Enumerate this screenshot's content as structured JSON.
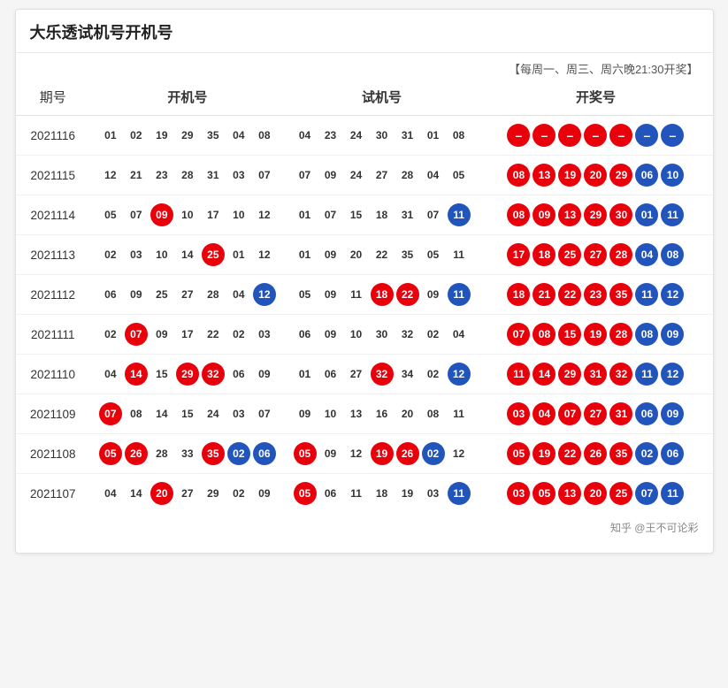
{
  "title": "大乐透试机号开机号",
  "subtitle": "【每周一、周三、周六晚21:30开奖】",
  "columns": [
    "期号",
    "开机号",
    "试机号",
    "开奖号"
  ],
  "rows": [
    {
      "period": "2021116",
      "kaiji": [
        {
          "val": "01",
          "type": "plain"
        },
        {
          "val": "02",
          "type": "plain"
        },
        {
          "val": "19",
          "type": "plain"
        },
        {
          "val": "29",
          "type": "plain"
        },
        {
          "val": "35",
          "type": "plain"
        },
        {
          "val": "04",
          "type": "plain"
        },
        {
          "val": "08",
          "type": "plain"
        }
      ],
      "shiji": [
        {
          "val": "04",
          "type": "plain"
        },
        {
          "val": "23",
          "type": "plain"
        },
        {
          "val": "24",
          "type": "plain"
        },
        {
          "val": "30",
          "type": "plain"
        },
        {
          "val": "31",
          "type": "plain"
        },
        {
          "val": "01",
          "type": "plain"
        },
        {
          "val": "08",
          "type": "plain"
        }
      ],
      "kaijiang": [
        {
          "val": "–",
          "type": "dash"
        },
        {
          "val": "–",
          "type": "dash"
        },
        {
          "val": "–",
          "type": "dash"
        },
        {
          "val": "–",
          "type": "dash"
        },
        {
          "val": "–",
          "type": "dash"
        },
        {
          "val": "–",
          "type": "dash-blue"
        },
        {
          "val": "–",
          "type": "dash-blue"
        }
      ]
    },
    {
      "period": "2021115",
      "kaiji": [
        {
          "val": "12",
          "type": "plain"
        },
        {
          "val": "21",
          "type": "plain"
        },
        {
          "val": "23",
          "type": "plain"
        },
        {
          "val": "28",
          "type": "plain"
        },
        {
          "val": "31",
          "type": "plain"
        },
        {
          "val": "03",
          "type": "plain"
        },
        {
          "val": "07",
          "type": "plain"
        }
      ],
      "shiji": [
        {
          "val": "07",
          "type": "plain"
        },
        {
          "val": "09",
          "type": "plain"
        },
        {
          "val": "24",
          "type": "plain"
        },
        {
          "val": "27",
          "type": "plain"
        },
        {
          "val": "28",
          "type": "plain"
        },
        {
          "val": "04",
          "type": "plain"
        },
        {
          "val": "05",
          "type": "plain"
        }
      ],
      "kaijiang": [
        {
          "val": "08",
          "type": "red"
        },
        {
          "val": "13",
          "type": "red"
        },
        {
          "val": "19",
          "type": "red"
        },
        {
          "val": "20",
          "type": "red"
        },
        {
          "val": "29",
          "type": "red"
        },
        {
          "val": "06",
          "type": "blue"
        },
        {
          "val": "10",
          "type": "blue"
        }
      ]
    },
    {
      "period": "2021114",
      "kaiji": [
        {
          "val": "05",
          "type": "plain"
        },
        {
          "val": "07",
          "type": "plain"
        },
        {
          "val": "09",
          "type": "red"
        },
        {
          "val": "10",
          "type": "plain"
        },
        {
          "val": "17",
          "type": "plain"
        },
        {
          "val": "10",
          "type": "plain"
        },
        {
          "val": "12",
          "type": "plain"
        }
      ],
      "shiji": [
        {
          "val": "01",
          "type": "plain"
        },
        {
          "val": "07",
          "type": "plain"
        },
        {
          "val": "15",
          "type": "plain"
        },
        {
          "val": "18",
          "type": "plain"
        },
        {
          "val": "31",
          "type": "plain"
        },
        {
          "val": "07",
          "type": "plain"
        },
        {
          "val": "11",
          "type": "blue"
        }
      ],
      "kaijiang": [
        {
          "val": "08",
          "type": "red"
        },
        {
          "val": "09",
          "type": "red"
        },
        {
          "val": "13",
          "type": "red"
        },
        {
          "val": "29",
          "type": "red"
        },
        {
          "val": "30",
          "type": "red"
        },
        {
          "val": "01",
          "type": "blue"
        },
        {
          "val": "11",
          "type": "blue"
        }
      ]
    },
    {
      "period": "2021113",
      "kaiji": [
        {
          "val": "02",
          "type": "plain"
        },
        {
          "val": "03",
          "type": "plain"
        },
        {
          "val": "10",
          "type": "plain"
        },
        {
          "val": "14",
          "type": "plain"
        },
        {
          "val": "25",
          "type": "red"
        },
        {
          "val": "01",
          "type": "plain"
        },
        {
          "val": "12",
          "type": "plain"
        }
      ],
      "shiji": [
        {
          "val": "01",
          "type": "plain"
        },
        {
          "val": "09",
          "type": "plain"
        },
        {
          "val": "20",
          "type": "plain"
        },
        {
          "val": "22",
          "type": "plain"
        },
        {
          "val": "35",
          "type": "plain"
        },
        {
          "val": "05",
          "type": "plain"
        },
        {
          "val": "11",
          "type": "plain"
        }
      ],
      "kaijiang": [
        {
          "val": "17",
          "type": "red"
        },
        {
          "val": "18",
          "type": "red"
        },
        {
          "val": "25",
          "type": "red"
        },
        {
          "val": "27",
          "type": "red"
        },
        {
          "val": "28",
          "type": "red"
        },
        {
          "val": "04",
          "type": "blue"
        },
        {
          "val": "08",
          "type": "blue"
        }
      ]
    },
    {
      "period": "2021112",
      "kaiji": [
        {
          "val": "06",
          "type": "plain"
        },
        {
          "val": "09",
          "type": "plain"
        },
        {
          "val": "25",
          "type": "plain"
        },
        {
          "val": "27",
          "type": "plain"
        },
        {
          "val": "28",
          "type": "plain"
        },
        {
          "val": "04",
          "type": "plain"
        },
        {
          "val": "12",
          "type": "blue"
        }
      ],
      "shiji": [
        {
          "val": "05",
          "type": "plain"
        },
        {
          "val": "09",
          "type": "plain"
        },
        {
          "val": "11",
          "type": "plain"
        },
        {
          "val": "18",
          "type": "red"
        },
        {
          "val": "22",
          "type": "red"
        },
        {
          "val": "09",
          "type": "plain"
        },
        {
          "val": "11",
          "type": "blue"
        }
      ],
      "kaijiang": [
        {
          "val": "18",
          "type": "red"
        },
        {
          "val": "21",
          "type": "red"
        },
        {
          "val": "22",
          "type": "red"
        },
        {
          "val": "23",
          "type": "red"
        },
        {
          "val": "35",
          "type": "red"
        },
        {
          "val": "11",
          "type": "blue"
        },
        {
          "val": "12",
          "type": "blue"
        }
      ]
    },
    {
      "period": "2021111",
      "kaiji": [
        {
          "val": "02",
          "type": "plain"
        },
        {
          "val": "07",
          "type": "red"
        },
        {
          "val": "09",
          "type": "plain"
        },
        {
          "val": "17",
          "type": "plain"
        },
        {
          "val": "22",
          "type": "plain"
        },
        {
          "val": "02",
          "type": "plain"
        },
        {
          "val": "03",
          "type": "plain"
        }
      ],
      "shiji": [
        {
          "val": "06",
          "type": "plain"
        },
        {
          "val": "09",
          "type": "plain"
        },
        {
          "val": "10",
          "type": "plain"
        },
        {
          "val": "30",
          "type": "plain"
        },
        {
          "val": "32",
          "type": "plain"
        },
        {
          "val": "02",
          "type": "plain"
        },
        {
          "val": "04",
          "type": "plain"
        }
      ],
      "kaijiang": [
        {
          "val": "07",
          "type": "red"
        },
        {
          "val": "08",
          "type": "red"
        },
        {
          "val": "15",
          "type": "red"
        },
        {
          "val": "19",
          "type": "red"
        },
        {
          "val": "28",
          "type": "red"
        },
        {
          "val": "08",
          "type": "blue"
        },
        {
          "val": "09",
          "type": "blue"
        }
      ]
    },
    {
      "period": "2021110",
      "kaiji": [
        {
          "val": "04",
          "type": "plain"
        },
        {
          "val": "14",
          "type": "red"
        },
        {
          "val": "15",
          "type": "plain"
        },
        {
          "val": "29",
          "type": "red"
        },
        {
          "val": "32",
          "type": "red"
        },
        {
          "val": "06",
          "type": "plain"
        },
        {
          "val": "09",
          "type": "plain"
        }
      ],
      "shiji": [
        {
          "val": "01",
          "type": "plain"
        },
        {
          "val": "06",
          "type": "plain"
        },
        {
          "val": "27",
          "type": "plain"
        },
        {
          "val": "32",
          "type": "red"
        },
        {
          "val": "34",
          "type": "plain"
        },
        {
          "val": "02",
          "type": "plain"
        },
        {
          "val": "12",
          "type": "blue"
        }
      ],
      "kaijiang": [
        {
          "val": "11",
          "type": "red"
        },
        {
          "val": "14",
          "type": "red"
        },
        {
          "val": "29",
          "type": "red"
        },
        {
          "val": "31",
          "type": "red"
        },
        {
          "val": "32",
          "type": "red"
        },
        {
          "val": "11",
          "type": "blue"
        },
        {
          "val": "12",
          "type": "blue"
        }
      ]
    },
    {
      "period": "2021109",
      "kaiji": [
        {
          "val": "07",
          "type": "red"
        },
        {
          "val": "08",
          "type": "plain"
        },
        {
          "val": "14",
          "type": "plain"
        },
        {
          "val": "15",
          "type": "plain"
        },
        {
          "val": "24",
          "type": "plain"
        },
        {
          "val": "03",
          "type": "plain"
        },
        {
          "val": "07",
          "type": "plain"
        }
      ],
      "shiji": [
        {
          "val": "09",
          "type": "plain"
        },
        {
          "val": "10",
          "type": "plain"
        },
        {
          "val": "13",
          "type": "plain"
        },
        {
          "val": "16",
          "type": "plain"
        },
        {
          "val": "20",
          "type": "plain"
        },
        {
          "val": "08",
          "type": "plain"
        },
        {
          "val": "11",
          "type": "plain"
        }
      ],
      "kaijiang": [
        {
          "val": "03",
          "type": "red"
        },
        {
          "val": "04",
          "type": "red"
        },
        {
          "val": "07",
          "type": "red"
        },
        {
          "val": "27",
          "type": "red"
        },
        {
          "val": "31",
          "type": "red"
        },
        {
          "val": "06",
          "type": "blue"
        },
        {
          "val": "09",
          "type": "blue"
        }
      ]
    },
    {
      "period": "2021108",
      "kaiji": [
        {
          "val": "05",
          "type": "red"
        },
        {
          "val": "26",
          "type": "red"
        },
        {
          "val": "28",
          "type": "plain"
        },
        {
          "val": "33",
          "type": "plain"
        },
        {
          "val": "35",
          "type": "red"
        },
        {
          "val": "02",
          "type": "blue"
        },
        {
          "val": "06",
          "type": "blue"
        }
      ],
      "shiji": [
        {
          "val": "05",
          "type": "red"
        },
        {
          "val": "09",
          "type": "plain"
        },
        {
          "val": "12",
          "type": "plain"
        },
        {
          "val": "19",
          "type": "red"
        },
        {
          "val": "26",
          "type": "red"
        },
        {
          "val": "02",
          "type": "blue"
        },
        {
          "val": "12",
          "type": "plain"
        }
      ],
      "kaijiang": [
        {
          "val": "05",
          "type": "red"
        },
        {
          "val": "19",
          "type": "red"
        },
        {
          "val": "22",
          "type": "red"
        },
        {
          "val": "26",
          "type": "red"
        },
        {
          "val": "35",
          "type": "red"
        },
        {
          "val": "02",
          "type": "blue"
        },
        {
          "val": "06",
          "type": "blue"
        }
      ]
    },
    {
      "period": "2021107",
      "kaiji": [
        {
          "val": "04",
          "type": "plain"
        },
        {
          "val": "14",
          "type": "plain"
        },
        {
          "val": "20",
          "type": "red"
        },
        {
          "val": "27",
          "type": "plain"
        },
        {
          "val": "29",
          "type": "plain"
        },
        {
          "val": "02",
          "type": "plain"
        },
        {
          "val": "09",
          "type": "plain"
        }
      ],
      "shiji": [
        {
          "val": "05",
          "type": "red"
        },
        {
          "val": "06",
          "type": "plain"
        },
        {
          "val": "11",
          "type": "plain"
        },
        {
          "val": "18",
          "type": "plain"
        },
        {
          "val": "19",
          "type": "plain"
        },
        {
          "val": "03",
          "type": "plain"
        },
        {
          "val": "11",
          "type": "blue"
        }
      ],
      "kaijiang": [
        {
          "val": "03",
          "type": "red"
        },
        {
          "val": "05",
          "type": "red"
        },
        {
          "val": "13",
          "type": "red"
        },
        {
          "val": "20",
          "type": "red"
        },
        {
          "val": "25",
          "type": "red"
        },
        {
          "val": "07",
          "type": "blue"
        },
        {
          "val": "11",
          "type": "blue"
        }
      ]
    }
  ],
  "footer": "知乎 @王不可论彩"
}
